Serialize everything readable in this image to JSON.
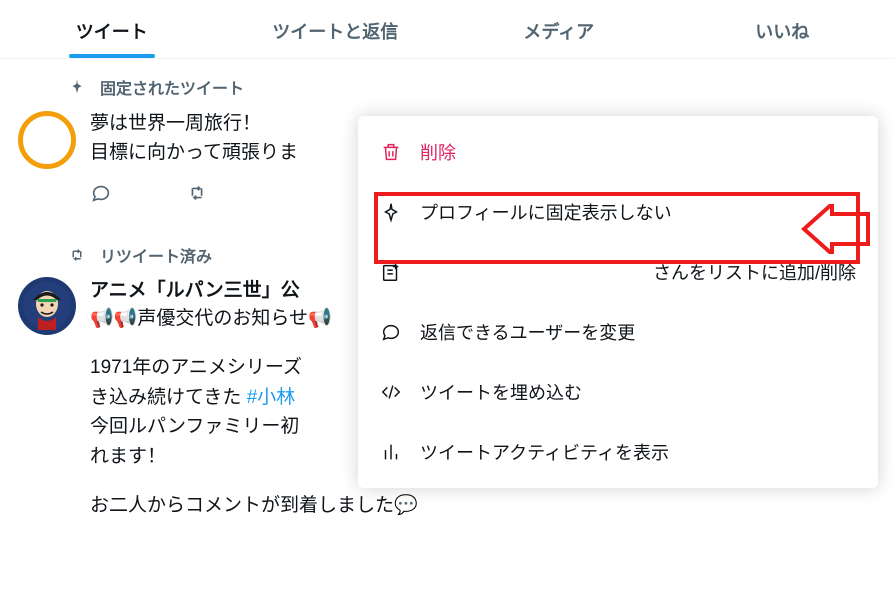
{
  "tabs": {
    "tweets": "ツイート",
    "replies": "ツイートと返信",
    "media": "メディア",
    "likes": "いいね"
  },
  "pinned": {
    "label": "固定されたツイート",
    "line1": "夢は世界一周旅行！",
    "line2": "目標に向かって頑張りま"
  },
  "retweeted_label": "リツイート済み",
  "second": {
    "author": "アニメ「ルパン三世」公",
    "subline_prefix": "📢声優交代のお知らせ",
    "body_line1a": "1971年のアニメシリーズ",
    "body_line1b": "き込み続けてきた ",
    "hashtag": "#小林",
    "body_line2": "今回ルパンファミリー初",
    "body_line3": "れます！",
    "body_line4": "お二人からコメントが到着しました💬"
  },
  "menu": {
    "delete": "削除",
    "unpin": "プロフィールに固定表示しない",
    "list": "さんをリストに追加/削除",
    "reply_settings": "返信できるユーザーを変更",
    "embed": "ツイートを埋め込む",
    "analytics": "ツイートアクティビティを表示"
  }
}
